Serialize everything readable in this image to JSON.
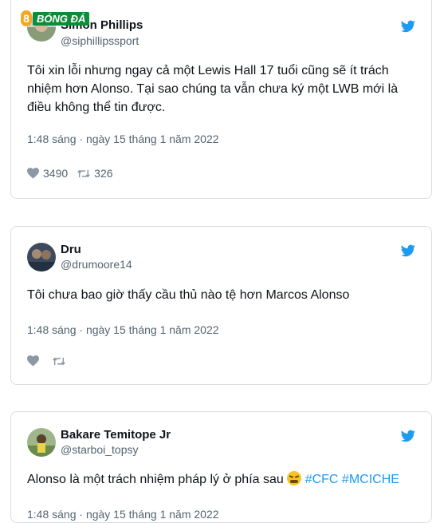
{
  "watermark": {
    "number": "8",
    "brand": "BÓNG ĐÁ"
  },
  "tweets": [
    {
      "name": "Simon Phillips",
      "handle": "@siphillipssport",
      "text": "Tôi xin lỗi nhưng ngay cả một Lewis Hall 17 tuổi cũng sẽ ít trách nhiệm hơn Alonso. Tại sao chúng ta vẫn chưa ký một LWB mới là điều không thể tin được.",
      "time": "1:48 sáng · ngày 15 tháng 1 năm 2022",
      "likes": "3490",
      "retweets": "326"
    },
    {
      "name": "Dru",
      "handle": "@drumoore14",
      "text": "Tôi chưa bao giờ thấy cầu thủ nào tệ hơn Marcos Alonso",
      "time": "1:48 sáng · ngày 15 tháng 1 năm 2022",
      "likes": "",
      "retweets": ""
    },
    {
      "name": "Bakare Temitope Jr",
      "handle": "@starboi_topsy",
      "text": "Alonso là một trách nhiệm pháp lý ở phía sau",
      "hashtags": "#CFC #MCICHE",
      "time": "1:48 sáng · ngày 15 tháng 1 năm 2022"
    }
  ],
  "colors": {
    "accent": "#1d9bf0",
    "muted": "#536471",
    "border": "#d9dee3"
  },
  "icons": [
    "twitter-bird-icon",
    "heart-icon",
    "retweet-icon",
    "weary-face-emoji"
  ]
}
